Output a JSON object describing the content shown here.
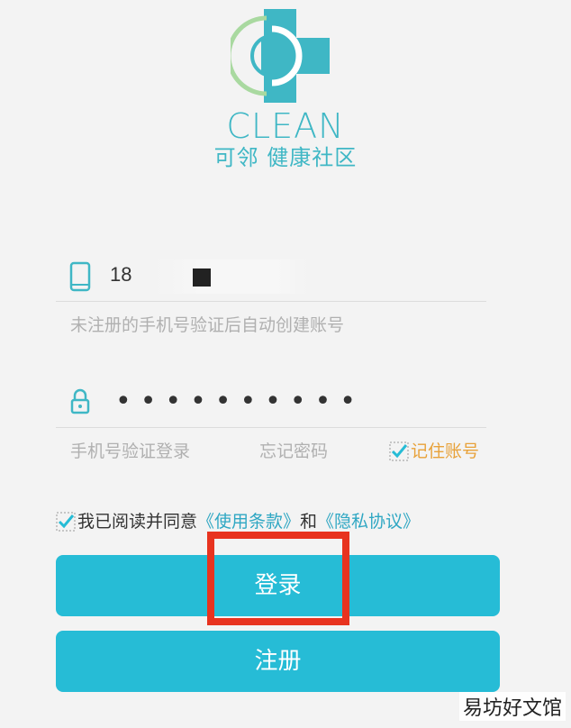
{
  "brand": {
    "wordmark": "CLEAN",
    "subtitle": "可邻 健康社区",
    "accent": "#3fb7c5",
    "mark_icon": "medical-cross-logo"
  },
  "phone": {
    "value": "18",
    "icon": "phone-icon",
    "hint": "未注册的手机号验证后自动创建账号"
  },
  "password": {
    "value": "••••••••••",
    "icon": "lock-icon"
  },
  "options": {
    "sms_login": "手机号验证登录",
    "forgot": "忘记密码",
    "remember": "记住账号",
    "remember_checked": true
  },
  "agreement": {
    "checked": true,
    "prefix": "我已阅读并同意",
    "terms": "《使用条款》",
    "and": "和",
    "privacy": "《隐私协议》"
  },
  "buttons": {
    "login": "登录",
    "register": "注册",
    "color": "#26bcd6"
  },
  "highlight_color": "#e8331f",
  "watermark": "易坊好文馆"
}
